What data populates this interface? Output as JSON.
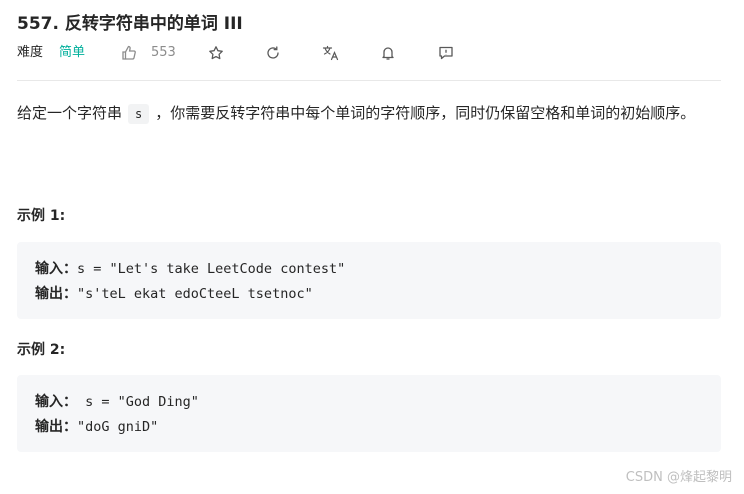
{
  "problem": {
    "title": "557. 反转字符串中的单词 III",
    "difficulty_label": "难度",
    "difficulty_value": "简单",
    "likes": "553"
  },
  "icons": {
    "like": "thumbs-up-icon",
    "star": "star-icon",
    "share": "share-icon",
    "translate": "translate-icon",
    "bell": "bell-icon",
    "feedback": "feedback-icon"
  },
  "description": {
    "before_code": "给定一个字符串",
    "code": "s",
    "after_code": "，你需要反转字符串中每个单词的字符顺序，同时仍保留空格和单词的初始顺序。"
  },
  "examples": [
    {
      "heading": "示例 1:",
      "input_label": "输入：",
      "input_value": "s = \"Let's take LeetCode contest\"",
      "output_label": "输出：",
      "output_value": "\"s'teL ekat edoCteeL tsetnoc\""
    },
    {
      "heading": "示例 2:",
      "input_label": "输入：",
      "input_value": " s = \"God Ding\"",
      "output_label": "输出：",
      "output_value": "\"doG gniD\""
    }
  ],
  "watermark": "CSDN @烽起黎明",
  "colors": {
    "accent_easy": "#00af9b",
    "code_bg": "#f6f7f9",
    "muted": "#8c8c8c"
  }
}
